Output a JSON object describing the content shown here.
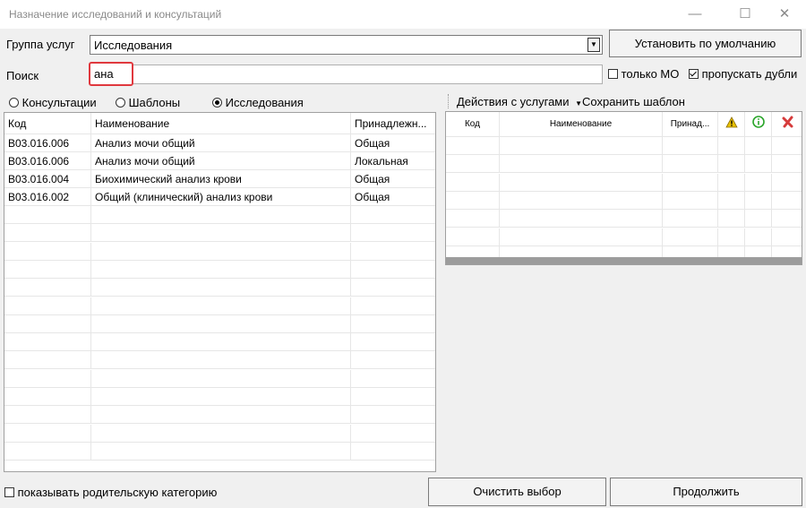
{
  "window": {
    "title": "Назначение исследований и консультаций",
    "minimize": "—",
    "maximize": "☐",
    "close": "✕"
  },
  "group": {
    "label": "Группа услуг",
    "value": "Исследования",
    "default_button": "Установить по умолчанию"
  },
  "search": {
    "label": "Поиск",
    "value": "ана"
  },
  "options": {
    "only_mo": "только МО",
    "only_mo_checked": false,
    "skip_dupes": "пропускать дубли",
    "skip_dupes_checked": true
  },
  "radios": [
    {
      "label": "Консультации",
      "selected": false
    },
    {
      "label": "Шаблоны",
      "selected": false
    },
    {
      "label": "Исследования",
      "selected": true
    }
  ],
  "left_table": {
    "columns": [
      "Код",
      "Наименование",
      "Принадлежн..."
    ],
    "rows": [
      [
        "B03.016.006",
        "Анализ мочи общий",
        "Общая"
      ],
      [
        "B03.016.006",
        "Анализ мочи общий",
        "Локальная"
      ],
      [
        "B03.016.004",
        "Биохимический анализ крови",
        "Общая"
      ],
      [
        "B03.016.002",
        "Общий (клинический) анализ крови",
        "Общая"
      ]
    ]
  },
  "right_toolbar": {
    "actions": "Действия с услугами",
    "save_template": "Сохранить шаблон"
  },
  "right_table": {
    "columns": [
      "Код",
      "Наименование",
      "Принад..."
    ]
  },
  "footer": {
    "show_parent": "показывать родительскую категорию",
    "clear": "Очистить выбор",
    "continue": "Продолжить"
  },
  "colors": {
    "highlight": "#e0383e",
    "warn": "#e8c000",
    "info": "#2aa52a",
    "remove": "#d63b3b"
  }
}
